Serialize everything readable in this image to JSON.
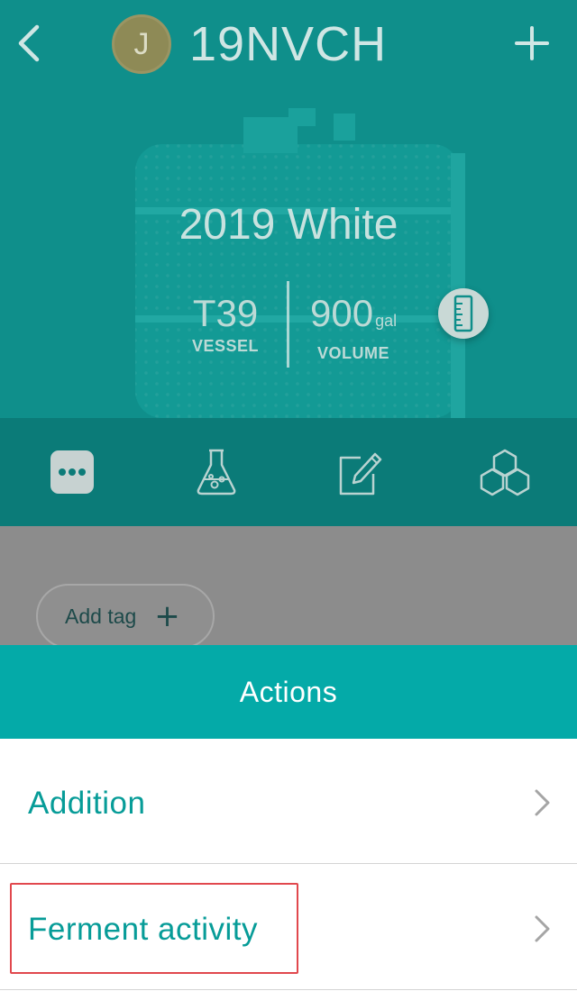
{
  "header": {
    "lot_code": "19NVCH",
    "avatar_initial": "J",
    "back_icon": "chevron-left-icon",
    "add_icon": "plus-icon"
  },
  "hero": {
    "wine_name": "2019 White",
    "vessel": {
      "value": "T39",
      "label": "VESSEL"
    },
    "volume": {
      "value": "900",
      "unit": "gal",
      "label": "VOLUME"
    },
    "measure_icon": "ruler-icon"
  },
  "tabs": [
    {
      "icon": "more-dots-icon"
    },
    {
      "icon": "lab-flask-icon"
    },
    {
      "icon": "edit-note-icon"
    },
    {
      "icon": "hexagons-icon"
    }
  ],
  "tags": {
    "add_label": "Add tag"
  },
  "actions": {
    "title": "Actions",
    "items": [
      {
        "label": "Addition"
      },
      {
        "label": "Ferment activity"
      }
    ]
  },
  "colors": {
    "accent": "#04aaa8",
    "accent_text": "#079c98",
    "hero_dim": "#0f8f8b",
    "tabbar_dim": "#0b7b78",
    "overlay_grey": "#8c8c8c",
    "highlight": "#e1484d"
  }
}
